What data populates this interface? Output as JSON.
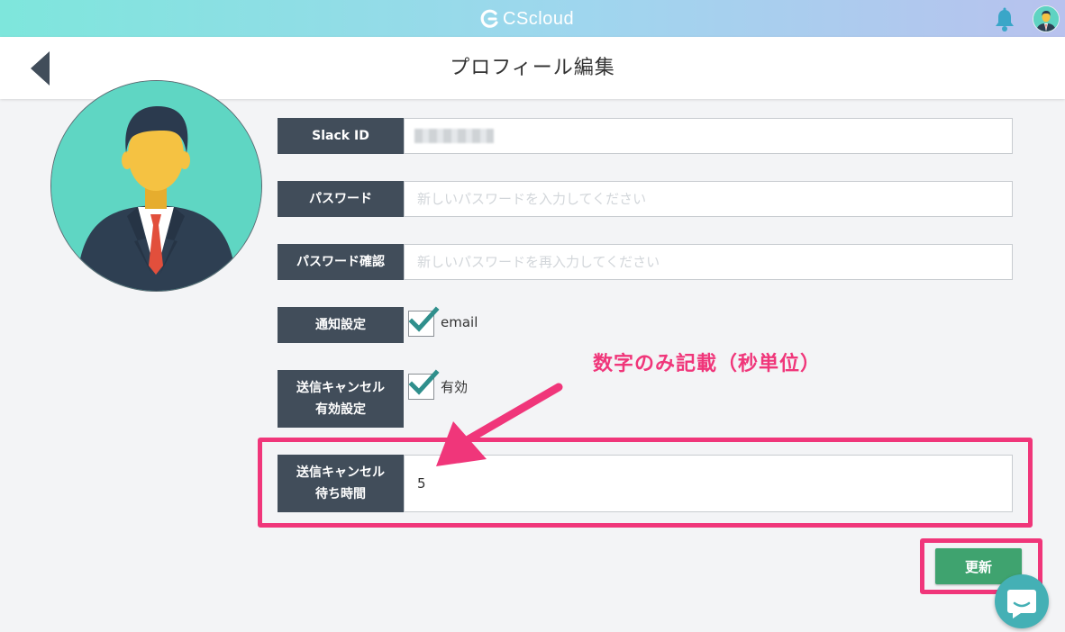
{
  "app": {
    "brand_name": "CScloud",
    "brand_color": "#ffffff"
  },
  "header": {
    "title": "プロフィール編集",
    "back_icon": "chevron-left-icon"
  },
  "form": {
    "slack_id": {
      "label": "Slack ID",
      "value": ""
    },
    "password": {
      "label": "パスワード",
      "placeholder": "新しいパスワードを入力してください"
    },
    "password_confirm": {
      "label": "パスワード確認",
      "placeholder": "新しいパスワードを再入力してください"
    },
    "notification": {
      "label": "通知設定",
      "option": "email",
      "checked": true
    },
    "cancel_enabled": {
      "label_line1": "送信キャンセル",
      "label_line2": "有効設定",
      "option": "有効",
      "checked": true
    },
    "cancel_wait": {
      "label_line1": "送信キャンセル",
      "label_line2": "待ち時間",
      "value": "5"
    }
  },
  "annotation": {
    "text": "数字のみ記載（秒単位）",
    "color": "#f0367a"
  },
  "actions": {
    "update_label": "更新",
    "update_color": "#3fa36f"
  },
  "icons": {
    "notification": "bell-icon",
    "user": "avatar",
    "chat": "chat-icon"
  }
}
